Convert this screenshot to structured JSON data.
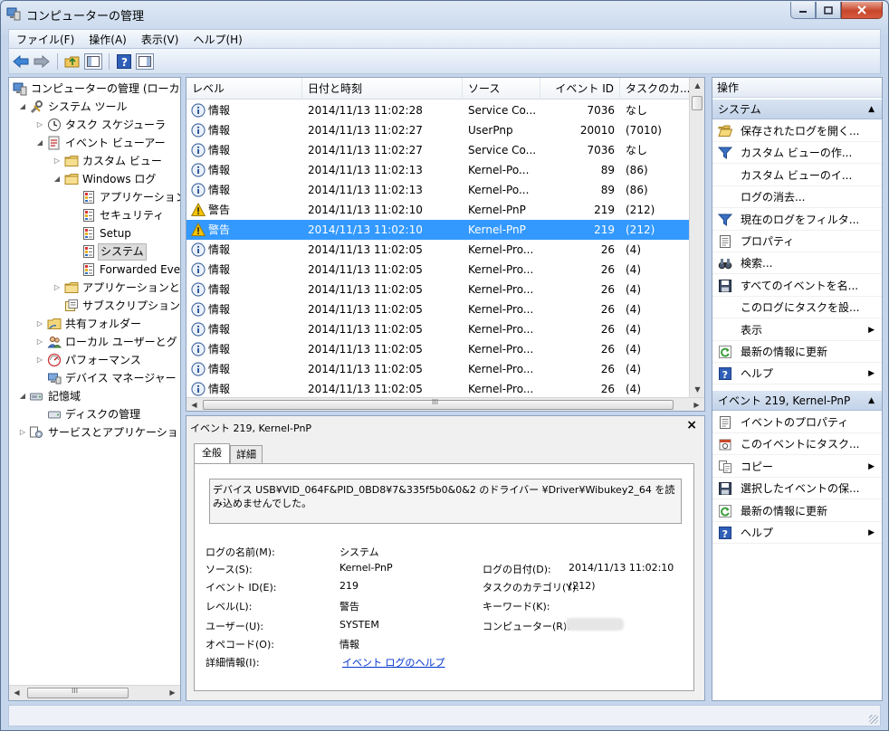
{
  "window": {
    "title": "コンピューターの管理"
  },
  "menu": [
    "ファイル(F)",
    "操作(A)",
    "表示(V)",
    "ヘルプ(H)"
  ],
  "tree": {
    "items": [
      {
        "label": "コンピューターの管理 (ローカ",
        "icon": "computer-management-icon"
      },
      {
        "label": "システム ツール",
        "icon": "tools-icon"
      },
      {
        "label": "タスク スケジューラ",
        "icon": "clock-icon"
      },
      {
        "label": "イベント ビューアー",
        "icon": "event-viewer-icon"
      },
      {
        "label": "カスタム ビュー",
        "icon": "folder-icon"
      },
      {
        "label": "Windows ログ",
        "icon": "folder-icon"
      },
      {
        "label": "アプリケーション",
        "icon": "log-icon"
      },
      {
        "label": "セキュリティ",
        "icon": "log-icon"
      },
      {
        "label": "Setup",
        "icon": "log-icon"
      },
      {
        "label": "システム",
        "icon": "log-icon"
      },
      {
        "label": "Forwarded Eve",
        "icon": "log-icon"
      },
      {
        "label": "アプリケーションと",
        "icon": "folder-icon"
      },
      {
        "label": "サブスクリプション",
        "icon": "subscription-icon"
      },
      {
        "label": "共有フォルダー",
        "icon": "shared-folder-icon"
      },
      {
        "label": "ローカル ユーザーとグ",
        "icon": "users-icon"
      },
      {
        "label": "パフォーマンス",
        "icon": "performance-icon"
      },
      {
        "label": "デバイス マネージャー",
        "icon": "device-manager-icon"
      },
      {
        "label": "記憶域",
        "icon": "storage-icon"
      },
      {
        "label": "ディスクの管理",
        "icon": "disk-icon"
      },
      {
        "label": "サービスとアプリケーショ",
        "icon": "services-icon"
      }
    ],
    "scroll_arrow_left": "◀",
    "scroll_arrow_right": "▶",
    "scroll_grip": "III"
  },
  "list": {
    "columns": [
      "レベル",
      "日付と時刻",
      "ソース",
      "イベント ID",
      "タスクのカ..."
    ],
    "rows": [
      {
        "level": "情報",
        "datetime": "2014/11/13 11:02:28",
        "source": "Service Co...",
        "event_id": "7036",
        "task": "なし"
      },
      {
        "level": "情報",
        "datetime": "2014/11/13 11:02:27",
        "source": "UserPnp",
        "event_id": "20010",
        "task": "(7010)"
      },
      {
        "level": "情報",
        "datetime": "2014/11/13 11:02:27",
        "source": "Service Co...",
        "event_id": "7036",
        "task": "なし"
      },
      {
        "level": "情報",
        "datetime": "2014/11/13 11:02:13",
        "source": "Kernel-Po...",
        "event_id": "89",
        "task": "(86)"
      },
      {
        "level": "情報",
        "datetime": "2014/11/13 11:02:13",
        "source": "Kernel-Po...",
        "event_id": "89",
        "task": "(86)"
      },
      {
        "level": "警告",
        "datetime": "2014/11/13 11:02:10",
        "source": "Kernel-PnP",
        "event_id": "219",
        "task": "(212)"
      },
      {
        "level": "警告",
        "datetime": "2014/11/13 11:02:10",
        "source": "Kernel-PnP",
        "event_id": "219",
        "task": "(212)"
      },
      {
        "level": "情報",
        "datetime": "2014/11/13 11:02:05",
        "source": "Kernel-Pro...",
        "event_id": "26",
        "task": "(4)"
      },
      {
        "level": "情報",
        "datetime": "2014/11/13 11:02:05",
        "source": "Kernel-Pro...",
        "event_id": "26",
        "task": "(4)"
      },
      {
        "level": "情報",
        "datetime": "2014/11/13 11:02:05",
        "source": "Kernel-Pro...",
        "event_id": "26",
        "task": "(4)"
      },
      {
        "level": "情報",
        "datetime": "2014/11/13 11:02:05",
        "source": "Kernel-Pro...",
        "event_id": "26",
        "task": "(4)"
      },
      {
        "level": "情報",
        "datetime": "2014/11/13 11:02:05",
        "source": "Kernel-Pro...",
        "event_id": "26",
        "task": "(4)"
      },
      {
        "level": "情報",
        "datetime": "2014/11/13 11:02:05",
        "source": "Kernel-Pro...",
        "event_id": "26",
        "task": "(4)"
      },
      {
        "level": "情報",
        "datetime": "2014/11/13 11:02:05",
        "source": "Kernel-Pro...",
        "event_id": "26",
        "task": "(4)"
      },
      {
        "level": "情報",
        "datetime": "2014/11/13 11:02:05",
        "source": "Kernel-Pro...",
        "event_id": "26",
        "task": "(4)"
      }
    ],
    "selected_row": 6,
    "scroll_grip": "III"
  },
  "detail": {
    "title": "イベント 219, Kernel-PnP",
    "close": "×",
    "tabs": [
      "全般",
      "詳細"
    ],
    "description": "デバイス USB¥VID_064F&PID_0BD8¥7&335f5b0&0&2 のドライバー ¥Driver¥Wibukey2_64 を読み込めませんでした。",
    "fields": {
      "log_name_label": "ログの名前(M):",
      "log_name": "システム",
      "source_label": "ソース(S):",
      "source": "Kernel-PnP",
      "logged_label": "ログの日付(D):",
      "logged": "2014/11/13 11:02:10",
      "event_id_label": "イベント ID(E):",
      "event_id": "219",
      "task_label": "タスクのカテゴリ(Y):",
      "task": "(212)",
      "level_label": "レベル(L):",
      "level": "警告",
      "keywords_label": "キーワード(K):",
      "user_label": "ユーザー(U):",
      "user": "SYSTEM",
      "computer_label": "コンピューター(R):",
      "opcode_label": "オペコード(O):",
      "opcode": "情報",
      "more_info_label": "詳細情報(I):",
      "more_info_link": "イベント ログのヘルプ"
    }
  },
  "actions": {
    "title": "操作",
    "section1": "システム",
    "section1_items": [
      {
        "label": "保存されたログを開く...",
        "icon": "folder-open-icon"
      },
      {
        "label": "カスタム ビューの作...",
        "icon": "filter-icon"
      },
      {
        "label": "カスタム ビューのイ...",
        "icon": ""
      },
      {
        "label": "ログの消去...",
        "icon": ""
      },
      {
        "label": "現在のログをフィルタ...",
        "icon": "filter-icon"
      },
      {
        "label": "プロパティ",
        "icon": "properties-icon"
      },
      {
        "label": "検索...",
        "icon": "binoculars-icon"
      },
      {
        "label": "すべてのイベントを名...",
        "icon": "save-icon"
      },
      {
        "label": "このログにタスクを設...",
        "icon": ""
      },
      {
        "label": "表示",
        "icon": "",
        "submenu": "▶"
      },
      {
        "label": "最新の情報に更新",
        "icon": "refresh-icon"
      },
      {
        "label": "ヘルプ",
        "icon": "help-icon",
        "submenu": "▶"
      }
    ],
    "section2": "イベント 219, Kernel-PnP",
    "section2_items": [
      {
        "label": "イベントのプロパティ",
        "icon": "properties-icon"
      },
      {
        "label": "このイベントにタスク...",
        "icon": "task-icon"
      },
      {
        "label": "コピー",
        "icon": "copy-icon",
        "submenu": "▶"
      },
      {
        "label": "選択したイベントの保...",
        "icon": "save-icon"
      },
      {
        "label": "最新の情報に更新",
        "icon": "refresh-icon"
      },
      {
        "label": "ヘルプ",
        "icon": "help-icon",
        "submenu": "▶"
      }
    ]
  },
  "colors": {
    "selection": "#3399ff",
    "section_header": "#c3d3e9",
    "link": "#0033cc"
  }
}
